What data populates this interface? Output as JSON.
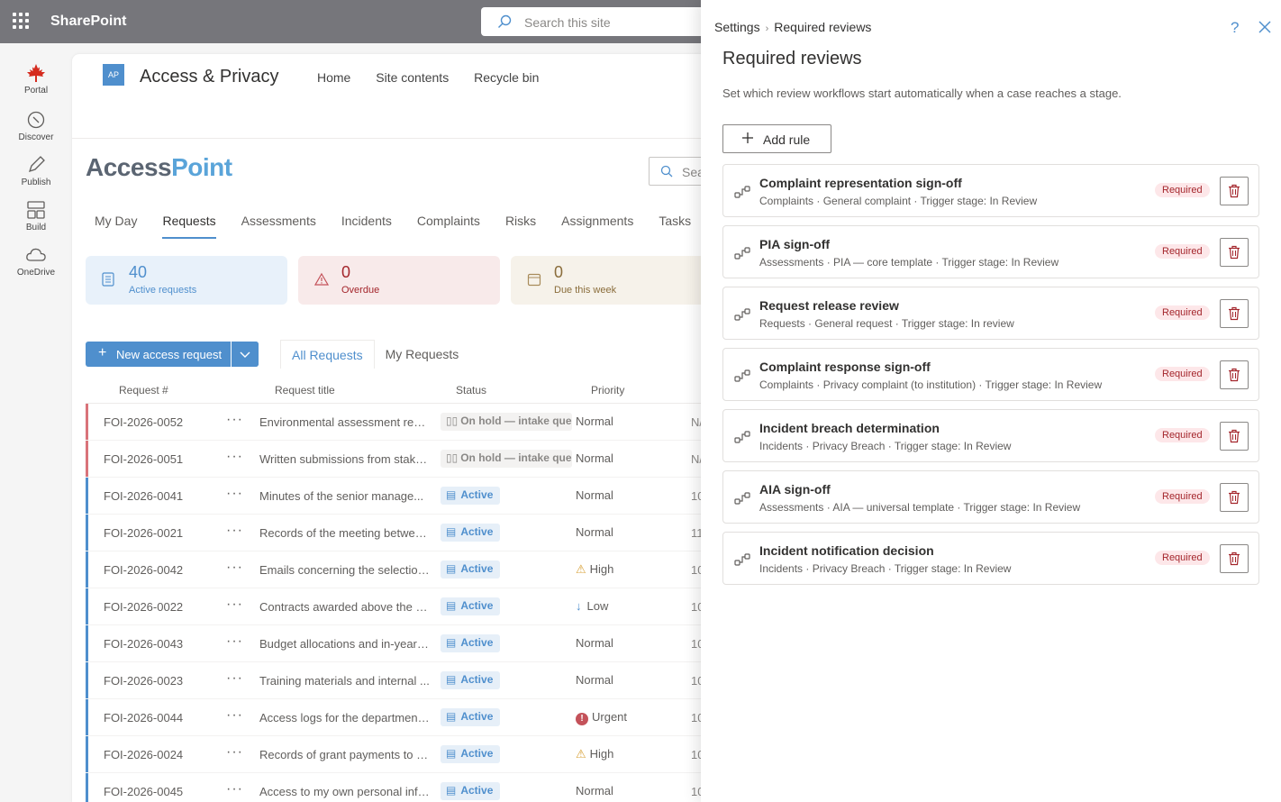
{
  "suite": {
    "title": "SharePoint",
    "search_placeholder": "Search this site"
  },
  "appbar": [
    {
      "label": "Portal",
      "icon": "maple-leaf-icon"
    },
    {
      "label": "Discover",
      "icon": "compass-icon"
    },
    {
      "label": "Publish",
      "icon": "pen-icon"
    },
    {
      "label": "Build",
      "icon": "layout-icon"
    },
    {
      "label": "OneDrive",
      "icon": "cloud-icon"
    }
  ],
  "site": {
    "logo": "AP",
    "title": "Access & Privacy",
    "nav": [
      "Home",
      "Site contents",
      "Recycle bin"
    ],
    "brand_a": "Access",
    "brand_b": "Point",
    "search_placeholder": "Sea"
  },
  "tabs": [
    "My Day",
    "Requests",
    "Assessments",
    "Incidents",
    "Complaints",
    "Risks",
    "Assignments",
    "Tasks"
  ],
  "active_tab": "Requests",
  "cards": [
    {
      "value": "40",
      "label": "Active requests"
    },
    {
      "value": "0",
      "label": "Overdue"
    },
    {
      "value": "0",
      "label": "Due this week"
    }
  ],
  "new_request_label": "New access request",
  "views": [
    "All Requests",
    "My Requests"
  ],
  "table": {
    "headers": [
      "Request #",
      "Request title",
      "Status",
      "Priority"
    ],
    "rows": [
      {
        "id": "FOI-2026-0052",
        "title": "Environmental assessment reco...",
        "status": "On hold — intake queue",
        "kind": "hold",
        "priority": "Normal",
        "prio_icon": "",
        "extra": "N/"
      },
      {
        "id": "FOI-2026-0051",
        "title": "Written submissions from stake...",
        "status": "On hold — intake queue",
        "kind": "hold",
        "priority": "Normal",
        "prio_icon": "",
        "extra": "N/"
      },
      {
        "id": "FOI-2026-0041",
        "title": "Minutes of the senior manage...",
        "status": "Active",
        "kind": "active",
        "priority": "Normal",
        "prio_icon": "",
        "extra": "10"
      },
      {
        "id": "FOI-2026-0021",
        "title": "Records of the meeting betwee...",
        "status": "Active",
        "kind": "active",
        "priority": "Normal",
        "prio_icon": "",
        "extra": "11"
      },
      {
        "id": "FOI-2026-0042",
        "title": "Emails concerning the selection...",
        "status": "Active",
        "kind": "active",
        "priority": "High",
        "prio_icon": "⚠",
        "extra": "10"
      },
      {
        "id": "FOI-2026-0022",
        "title": "Contracts awarded above the p...",
        "status": "Active",
        "kind": "active",
        "priority": "Low",
        "prio_icon": "↓",
        "extra": "10"
      },
      {
        "id": "FOI-2026-0043",
        "title": "Budget allocations and in-year r...",
        "status": "Active",
        "kind": "active",
        "priority": "Normal",
        "prio_icon": "",
        "extra": "10"
      },
      {
        "id": "FOI-2026-0023",
        "title": "Training materials and internal ...",
        "status": "Active",
        "kind": "active",
        "priority": "Normal",
        "prio_icon": "",
        "extra": "10"
      },
      {
        "id": "FOI-2026-0044",
        "title": "Access logs for the department...",
        "status": "Active",
        "kind": "active",
        "priority": "Urgent",
        "prio_icon": "!",
        "extra": "10"
      },
      {
        "id": "FOI-2026-0024",
        "title": "Records of grant payments to a...",
        "status": "Active",
        "kind": "active",
        "priority": "High",
        "prio_icon": "⚠",
        "extra": "10"
      },
      {
        "id": "FOI-2026-0045",
        "title": "Access to my own personal info...",
        "status": "Active",
        "kind": "active",
        "priority": "Normal",
        "prio_icon": "",
        "extra": "10"
      }
    ]
  },
  "panel": {
    "crumb_root": "Settings",
    "crumb_current": "Required reviews",
    "title": "Required reviews",
    "description": "Set which review workflows start automatically when a case reaches a stage.",
    "add_rule": "Add rule",
    "rules": [
      {
        "title": "Complaint representation sign-off",
        "meta": "Complaints · General complaint · Trigger stage: In Review",
        "badge": "Required"
      },
      {
        "title": "PIA sign-off",
        "meta": "Assessments · PIA — core template · Trigger stage: In Review",
        "badge": "Required"
      },
      {
        "title": "Request release review",
        "meta": "Requests · General request · Trigger stage: In review",
        "badge": "Required"
      },
      {
        "title": "Complaint response sign-off",
        "meta": "Complaints · Privacy complaint (to institution) · Trigger stage: In Review",
        "badge": "Required"
      },
      {
        "title": "Incident breach determination",
        "meta": "Incidents · Privacy Breach · Trigger stage: In Review",
        "badge": "Required"
      },
      {
        "title": "AIA sign-off",
        "meta": "Assessments · AIA — universal template · Trigger stage: In Review",
        "badge": "Required"
      },
      {
        "title": "Incident notification decision",
        "meta": "Incidents · Privacy Breach · Trigger stage: In Review",
        "badge": "Required"
      }
    ]
  },
  "colors": {
    "accent": "#4f8fcd",
    "hold_bar": "#d9737a",
    "required_text": "#a4262c",
    "required_bg": "#fde7e9"
  }
}
